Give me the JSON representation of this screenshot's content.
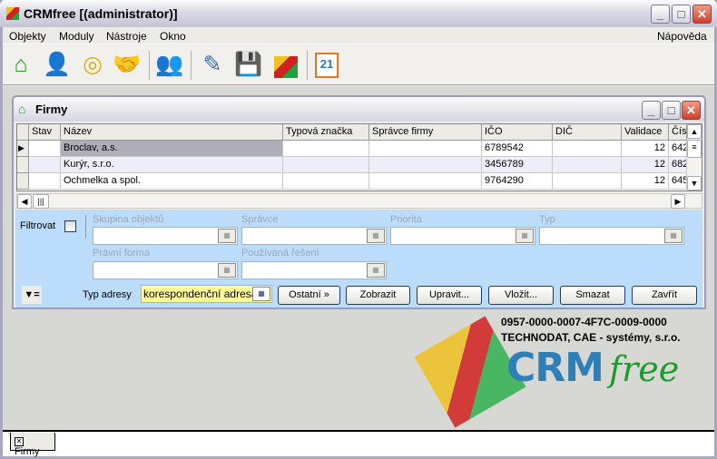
{
  "window": {
    "title": "CRMfree [(administrator)]"
  },
  "menu": {
    "items": [
      "Objekty",
      "Moduly",
      "Nástroje",
      "Okno"
    ],
    "help": "Nápověda"
  },
  "toolbar": {
    "icons": [
      "home-icon",
      "person-icon",
      "coins-icon",
      "handshake-icon",
      "users-icon",
      "edit-document-icon",
      "save-icon",
      "logo-icon",
      "calendar-icon"
    ],
    "calendar_day": "21"
  },
  "child": {
    "title": "Firmy"
  },
  "grid": {
    "columns": [
      "Stav",
      "Název",
      "Typová značka",
      "Správce firmy",
      "IČO",
      "DIČ",
      "Validace",
      "Čís"
    ],
    "rows": [
      {
        "stav": "",
        "nazev": "Broclav, a.s.",
        "typ": "",
        "spravce": "",
        "ico": "6789542",
        "dic": "",
        "validace": "12",
        "cis": "642"
      },
      {
        "stav": "",
        "nazev": "Kurýr, s.r.o.",
        "typ": "",
        "spravce": "",
        "ico": "3456789",
        "dic": "",
        "validace": "12",
        "cis": "682"
      },
      {
        "stav": "",
        "nazev": "Ochmelka a spol.",
        "typ": "",
        "spravce": "",
        "ico": "9764290",
        "dic": "",
        "validace": "12",
        "cis": "645"
      }
    ]
  },
  "filter": {
    "label": "Filtrovat",
    "checked": false,
    "skupina": "Skupina objektů",
    "spravce": "Správce",
    "priorita": "Priorita",
    "typ": "Typ",
    "pravni": "Právní forma",
    "reseni": "Používaná řešení",
    "typ_adresy_label": "Typ adresy",
    "typ_adresy_value": "korespondenční adresa"
  },
  "buttons": {
    "ostatni": "Ostatní »",
    "zobrazit": "Zobrazit",
    "upravit": "Upravit...",
    "vlozit": "Vložit...",
    "smazat": "Smazat",
    "zavrit": "Zavřít"
  },
  "branding": {
    "license": "0957-0000-0007-4F7C-0009-0000",
    "company": "TECHNODAT, CAE - systémy, s.r.o.",
    "logo_text": "CRMfree"
  },
  "tabs": [
    {
      "label": "Firmy"
    }
  ]
}
